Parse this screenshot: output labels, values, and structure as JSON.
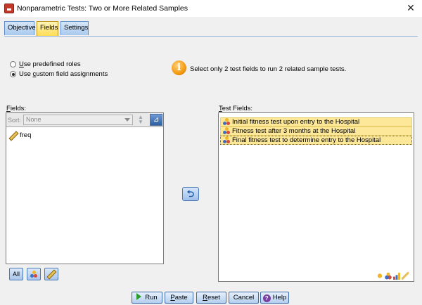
{
  "window": {
    "title": "Nonparametric Tests: Two or More Related Samples",
    "close_glyph": "✕"
  },
  "tabs": [
    {
      "label": "Objective",
      "active": false
    },
    {
      "label": "Fields",
      "active": true
    },
    {
      "label": "Settings",
      "active": false
    }
  ],
  "roles": {
    "predefined_prefix": "",
    "predefined_underline": "U",
    "predefined_rest": "se predefined roles",
    "custom_prefix": "Use ",
    "custom_underline": "c",
    "custom_rest": "ustom field assignments",
    "selected": "custom"
  },
  "info": {
    "icon_glyph": "i",
    "message": "Select only 2 test fields to run 2 related sample tests."
  },
  "fields_panel": {
    "label_underline": "F",
    "label_rest": "ields:",
    "sort_label": "Sort:",
    "sort_value": "None",
    "items": [
      {
        "name": "freq",
        "icon": "scale-ruler-icon"
      }
    ]
  },
  "fields_buttons": {
    "all_label": "All"
  },
  "test_fields": {
    "label_underline": "T",
    "label_rest": "est Fields:",
    "items": [
      {
        "name": "Initial fitness test upon entry to the Hospital",
        "icon": "nominal-icon"
      },
      {
        "name": "Fitness test after 3 months at the Hospital",
        "icon": "nominal-icon"
      },
      {
        "name": "Final fitness test to determine entry to the Hospital",
        "icon": "nominal-icon"
      }
    ]
  },
  "footer": {
    "run": "Run",
    "paste_underline": "P",
    "paste_rest": "aste",
    "reset_underline": "R",
    "reset_rest": "eset",
    "cancel": "Cancel",
    "help": "Help"
  },
  "colors": {
    "selected_item": "#fde89a",
    "active_tab": "#ffdd55",
    "accent": "#2e5f9f"
  }
}
